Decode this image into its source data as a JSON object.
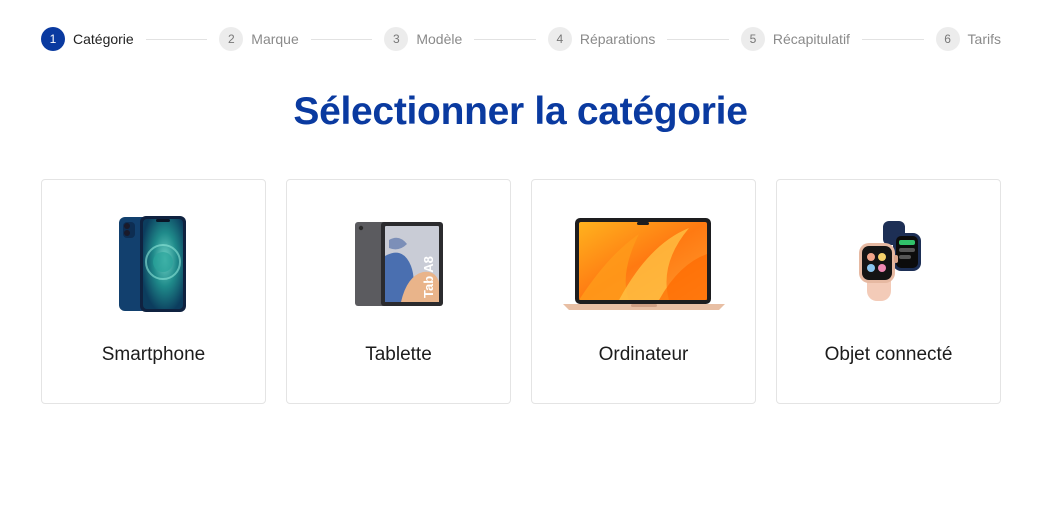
{
  "stepper": {
    "steps": [
      {
        "number": "1",
        "label": "Catégorie",
        "active": true
      },
      {
        "number": "2",
        "label": "Marque",
        "active": false
      },
      {
        "number": "3",
        "label": "Modèle",
        "active": false
      },
      {
        "number": "4",
        "label": "Réparations",
        "active": false
      },
      {
        "number": "5",
        "label": "Récapitulatif",
        "active": false
      },
      {
        "number": "6",
        "label": "Tarifs",
        "active": false
      }
    ]
  },
  "page": {
    "title": "Sélectionner la catégorie"
  },
  "categories": [
    {
      "label": "Smartphone",
      "icon": "smartphone-icon"
    },
    {
      "label": "Tablette",
      "icon": "tablet-icon"
    },
    {
      "label": "Ordinateur",
      "icon": "laptop-icon"
    },
    {
      "label": "Objet connecté",
      "icon": "smartwatch-icon"
    }
  ],
  "colors": {
    "accent": "#0a3aa0",
    "step_inactive_bg": "#ececec",
    "card_border": "#e4e4e4"
  },
  "product_image_text": {
    "tablet_brand": "Tab A8"
  }
}
